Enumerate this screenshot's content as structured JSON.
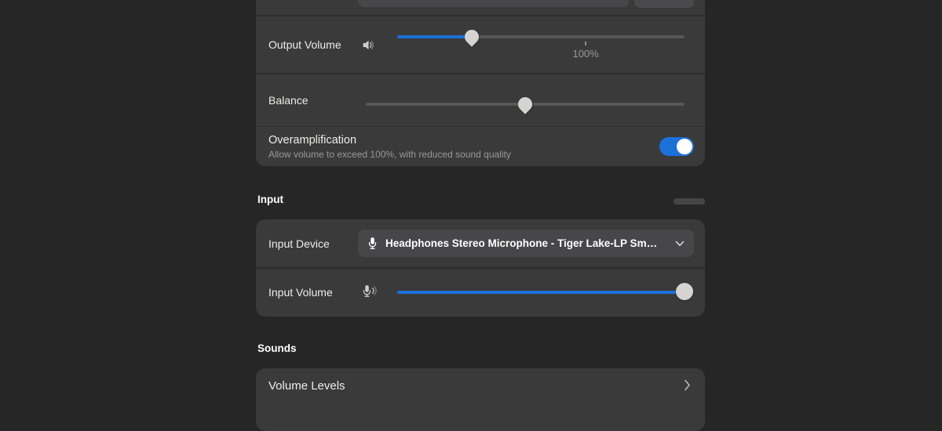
{
  "colors": {
    "accent": "#1c71d8",
    "window_bg": "#262627",
    "card_bg": "#3a3a3a"
  },
  "output_section": {
    "output_volume": {
      "label": "Output Volume",
      "fill_percent": 26,
      "mark_percent": 65.6,
      "mark_label": "100%"
    },
    "balance": {
      "label": "Balance",
      "position_percent": 50
    },
    "overamplification": {
      "label": "Overamplification",
      "subtitle": "Allow volume to exceed 100%, with reduced sound quality",
      "enabled": true
    }
  },
  "input_section": {
    "header": "Input",
    "input_device": {
      "label": "Input Device",
      "selected_value": "Headphones Stereo Microphone - Tiger Lake-LP Sm…"
    },
    "input_volume": {
      "label": "Input Volume",
      "fill_percent": 100
    }
  },
  "sounds_section": {
    "header": "Sounds",
    "volume_levels": {
      "label": "Volume Levels"
    }
  }
}
